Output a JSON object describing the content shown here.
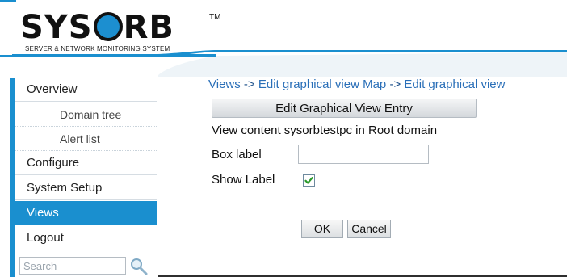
{
  "brand": {
    "logo_pre": "SYS",
    "logo_post": "RB",
    "trademark": "TM",
    "subtitle": "SERVER & NETWORK MONITORING SYSTEM",
    "accent_color": "#1a8fcf"
  },
  "nav": {
    "items": [
      {
        "label": "Overview",
        "type": "main"
      },
      {
        "label": "Domain tree",
        "type": "sub"
      },
      {
        "label": "Alert list",
        "type": "sub"
      },
      {
        "label": "Configure",
        "type": "main"
      },
      {
        "label": "System Setup",
        "type": "main"
      },
      {
        "label": "Views",
        "type": "main",
        "active": true
      },
      {
        "label": "Logout",
        "type": "main"
      }
    ],
    "search_placeholder": "Search"
  },
  "breadcrumb": {
    "part1": "Views",
    "sep": "->",
    "part2": "Edit graphical view Map",
    "part3": "Edit graphical view"
  },
  "panel": {
    "title": "Edit Graphical View Entry",
    "content_text": "View content sysorbtestpc in Root domain",
    "box_label_label": "Box label",
    "box_label_value": "",
    "show_label_label": "Show Label",
    "show_label_checked": true
  },
  "buttons": {
    "ok": "OK",
    "cancel": "Cancel"
  }
}
